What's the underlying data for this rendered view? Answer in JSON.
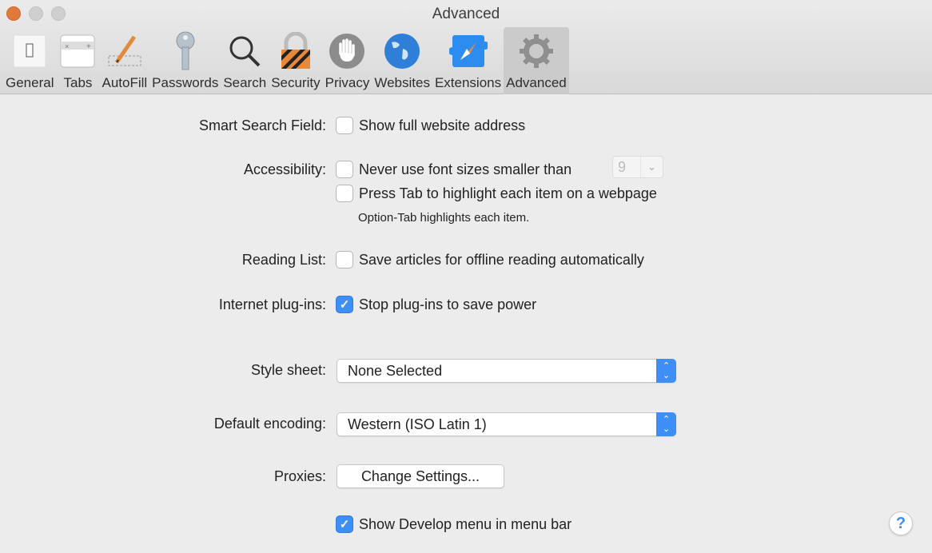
{
  "window": {
    "title": "Advanced"
  },
  "toolbar": [
    {
      "label": "General",
      "icon": "general-switch-icon"
    },
    {
      "label": "Tabs",
      "icon": "tabs-icon"
    },
    {
      "label": "AutoFill",
      "icon": "pencil-icon"
    },
    {
      "label": "Passwords",
      "icon": "key-icon"
    },
    {
      "label": "Search",
      "icon": "magnifier-icon"
    },
    {
      "label": "Security",
      "icon": "lock-icon"
    },
    {
      "label": "Privacy",
      "icon": "hand-icon"
    },
    {
      "label": "Websites",
      "icon": "globe-icon"
    },
    {
      "label": "Extensions",
      "icon": "puzzle-compass-icon"
    },
    {
      "label": "Advanced",
      "icon": "gear-icon",
      "active": true
    }
  ],
  "settings": {
    "smart_search": {
      "label": "Smart Search Field:",
      "option": "Show full website address",
      "checked": false
    },
    "accessibility": {
      "label": "Accessibility:",
      "font_size_option": "Never use font sizes smaller than",
      "font_size_checked": false,
      "font_size_value": "9",
      "tab_option": "Press Tab to highlight each item on a webpage",
      "tab_checked": false,
      "hint": "Option-Tab highlights each item."
    },
    "reading_list": {
      "label": "Reading List:",
      "option": "Save articles for offline reading automatically",
      "checked": false
    },
    "plugins": {
      "label": "Internet plug-ins:",
      "option": "Stop plug-ins to save power",
      "checked": true
    },
    "style_sheet": {
      "label": "Style sheet:",
      "value": "None Selected"
    },
    "encoding": {
      "label": "Default encoding:",
      "value": "Western (ISO Latin 1)"
    },
    "proxies": {
      "label": "Proxies:",
      "button": "Change Settings..."
    },
    "develop": {
      "option": "Show Develop menu in menu bar",
      "checked": true
    }
  },
  "help": {
    "glyph": "?"
  },
  "colors": {
    "accent": "#3d8ef5",
    "close": "#e07a3a"
  }
}
